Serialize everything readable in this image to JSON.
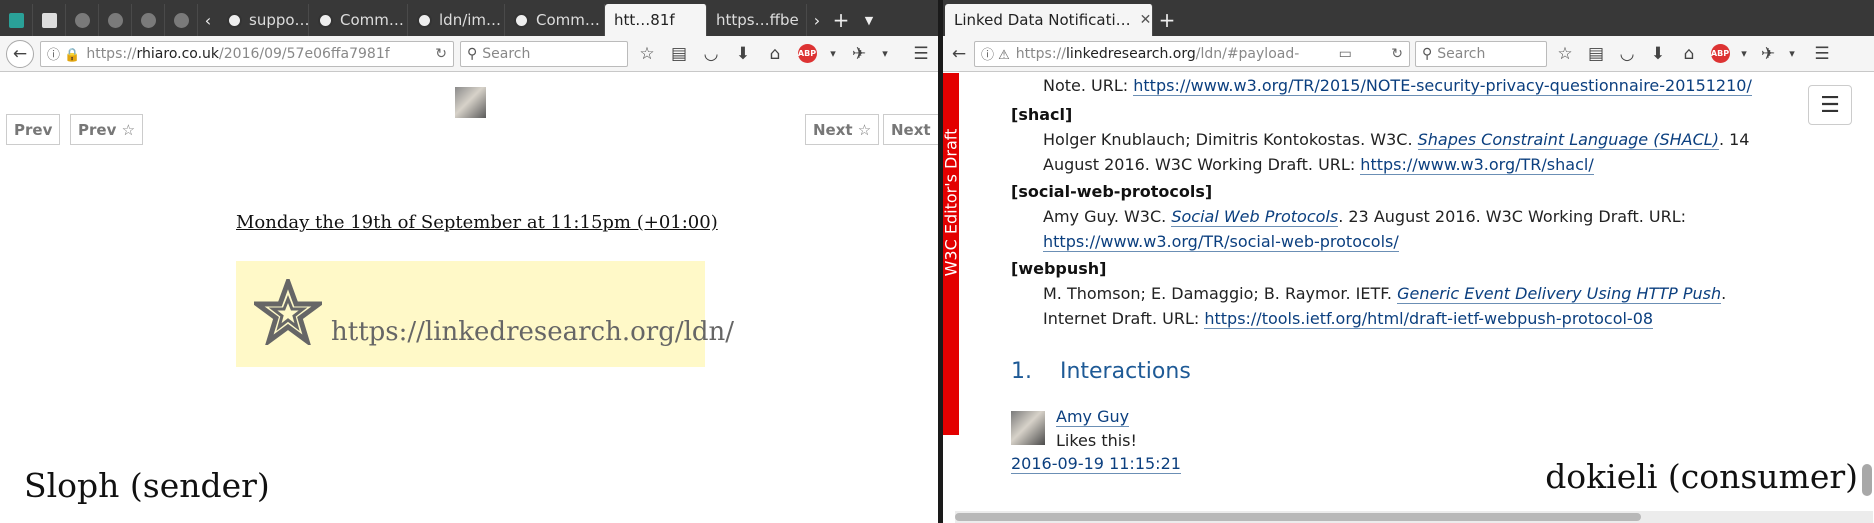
{
  "left": {
    "tabs": [
      {
        "label": "",
        "icon": "firefox-icon",
        "pinned": true
      },
      {
        "label": "",
        "icon": "page-icon",
        "pinned": true
      },
      {
        "label": "",
        "icon": "firefox-icon",
        "pinned": true
      },
      {
        "label": "",
        "icon": "firefox-icon",
        "pinned": true
      },
      {
        "label": "",
        "icon": "firefox-icon",
        "pinned": true
      },
      {
        "label": "",
        "icon": "firefox-icon",
        "pinned": true
      },
      {
        "label": "suppo…",
        "icon": "github-icon"
      },
      {
        "label": "Comm…",
        "icon": "github-icon"
      },
      {
        "label": "ldn/im…",
        "icon": "github-icon"
      },
      {
        "label": "Comm…",
        "icon": "github-icon"
      },
      {
        "label": "htt…81f",
        "icon": "none",
        "active": true
      },
      {
        "label": "https…ffbe",
        "icon": "none"
      }
    ],
    "url": {
      "prefix": "https://",
      "host": "rhiaro.co.uk",
      "path": "/2016/09/57e06ffa7981f"
    },
    "search_placeholder": "Search",
    "pager": {
      "prev": "Prev",
      "prev_star": "Prev ☆",
      "next_star": "Next ☆",
      "next": "Next"
    },
    "date": "Monday the 19th of September at 11:15pm (+01:00)",
    "like_url": "https://linkedresearch.org/ldn/",
    "caption": "Sloph (sender)"
  },
  "right": {
    "tab_title": "Linked Data Notificati…",
    "url": {
      "prefix": "https://",
      "host": "linkedresearch.org",
      "path": "/ldn/#payload-"
    },
    "search_placeholder": "Search",
    "side_label": "W3C Editor's Draft",
    "refs": {
      "top_line_prefix": "Note. URL: ",
      "top_line_url": "https://www.w3.org/TR/2015/NOTE-security-privacy-questionnaire-20151210/",
      "shacl_key": "[shacl]",
      "shacl_authors": "Holger Knublauch; Dimitris Kontokostas. W3C. ",
      "shacl_title": "Shapes Constraint Language (SHACL)",
      "shacl_rest": ". 14 August 2016. W3C Working Draft. URL: ",
      "shacl_url": "https://www.w3.org/TR/shacl/",
      "swp_key": "[social-web-protocols]",
      "swp_authors": "Amy Guy. W3C. ",
      "swp_title": "Social Web Protocols",
      "swp_rest": ". 23 August 2016. W3C Working Draft. URL: ",
      "swp_url": "https://www.w3.org/TR/social-web-protocols/",
      "webpush_key": "[webpush]",
      "webpush_authors": "M. Thomson; E. Damaggio; B. Raymor. IETF. ",
      "webpush_title": "Generic Event Delivery Using HTTP Push",
      "webpush_rest": ". Internet Draft. URL: ",
      "webpush_url": "https://tools.ietf.org/html/draft-ietf-webpush-protocol-08"
    },
    "section_heading": "1.    Interactions",
    "interaction": {
      "name": "Amy Guy",
      "text": "Likes this!",
      "date": "2016-09-19 11:15:21"
    },
    "caption": "dokieli (consumer)"
  },
  "colors": {
    "accent_red": "#e30000",
    "link": "#0b3f7f",
    "highlight": "#fff9c8"
  }
}
